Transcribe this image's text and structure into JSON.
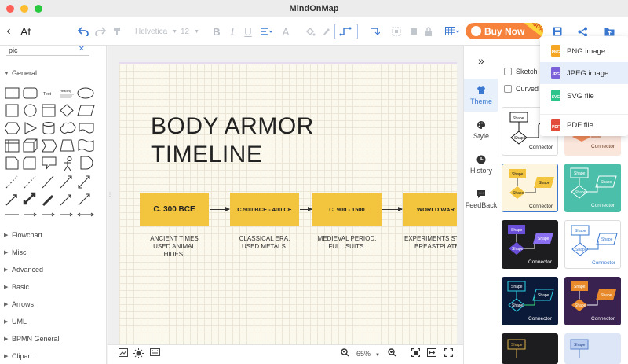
{
  "window": {
    "title": "MindOnMap"
  },
  "toolbar": {
    "doc_title": "At",
    "font_family": "Helvetica",
    "font_size": "12",
    "buy_label": "Buy Now",
    "discount": "-60%"
  },
  "left_panel": {
    "search_value": "pic",
    "general_label": "General",
    "shape_labels": [
      "Text",
      "Heading"
    ],
    "sections": [
      "Flowchart",
      "Misc",
      "Advanced",
      "Basic",
      "Arrows",
      "UML",
      "BPMN General",
      "Clipart"
    ]
  },
  "canvas": {
    "title_line1": "BODY ARMOR",
    "title_line2": "TIMELINE",
    "boxes": [
      "C. 300 BCE",
      "C.500 BCE - 400 CE",
      "C. 900 - 1500",
      "WORLD WAR"
    ],
    "captions": [
      [
        "ANCIENT TIMES",
        "USED ANIMAL",
        "HIDES."
      ],
      [
        "CLASSICAL ERA,",
        "USED METALS."
      ],
      [
        "MEDIEVAL PERIOD,",
        "FULL SUITS."
      ],
      [
        "EXPERIMENTS STI",
        "BREASTPLATE"
      ]
    ],
    "box_color": "#f3c53e"
  },
  "bottom_bar": {
    "zoom": "65%"
  },
  "right_tabs": [
    "Theme",
    "Style",
    "History",
    "FeedBack"
  ],
  "theme_panel": {
    "sketch_label": "Sketch",
    "curved_label": "Curved",
    "card_shape_label": "Shape",
    "card_connector_label": "Connector"
  },
  "export_menu": {
    "items": [
      {
        "label": "PNG image",
        "tag": "PNG"
      },
      {
        "label": "JPEG image",
        "tag": "JPG"
      },
      {
        "label": "SVG file",
        "tag": "SVG"
      },
      {
        "label": "PDF file",
        "tag": "PDF"
      }
    ]
  },
  "colors": {
    "accent": "#3a78d2",
    "buy": "#f6823c"
  }
}
